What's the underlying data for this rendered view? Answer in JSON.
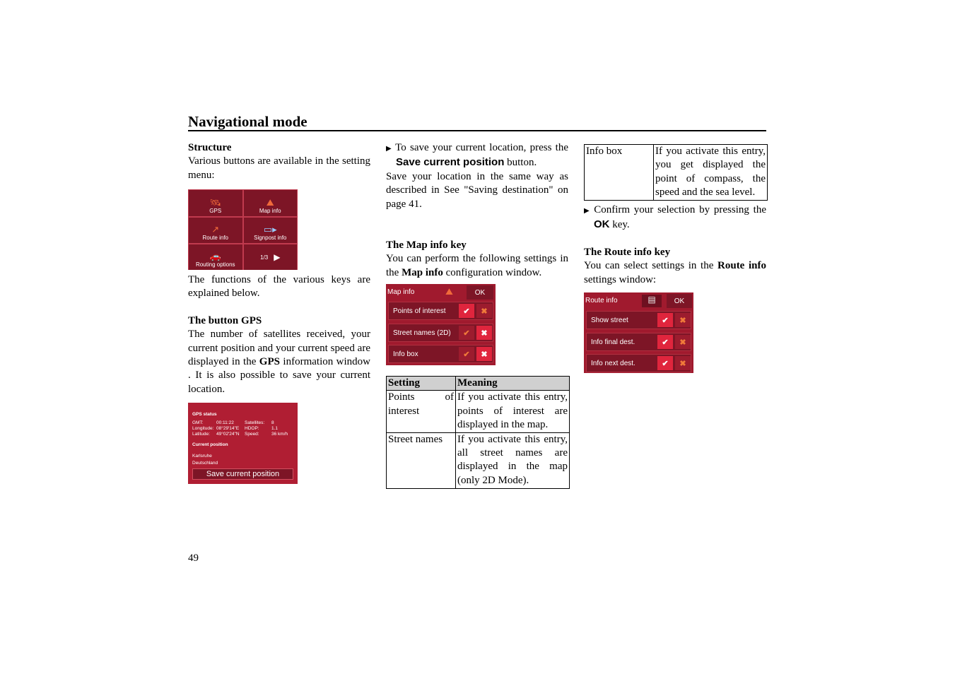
{
  "header": {
    "title": "Navigational mode"
  },
  "page_number": "49",
  "col1": {
    "structure_heading": "Structure",
    "structure_text": "Various buttons are available in the setting menu:",
    "menu": {
      "items": [
        "GPS",
        "Map info",
        "Route info",
        "Signpost info",
        "Routing options"
      ],
      "page": "1/3",
      "icons": [
        "satellite-icon",
        "map-icon",
        "route-icon",
        "signpost-icon",
        "routing-options-icon",
        "next-arrow-icon"
      ]
    },
    "functions_text": "The functions of the various keys are explained below.",
    "gps_heading": "The button GPS",
    "gps_text_1": "The number of satellites received, your current position and your current speed are displayed in the ",
    "gps_bold": "GPS",
    "gps_text_2": " information window . It is also possible to save your current location.",
    "gps_status": {
      "title": "GPS status",
      "gmt_label": "GMT:",
      "gmt": "00:11:22",
      "lon_label": "Longitude:",
      "lon": "08°29'14\"E",
      "lat_label": "Latitude:",
      "lat": "49°02'24\"N",
      "sat_label": "Satellites:",
      "sat": "8",
      "hdop_label": "HDOP:",
      "hdop": "1.1",
      "speed_label": "Speed:",
      "speed": "36 km/h",
      "position_title": "Current position",
      "city": "Karlsruhe",
      "country": "Deutschland",
      "save_button": "Save current position"
    }
  },
  "col2": {
    "bullet_1a": "To save your current location, press the ",
    "bullet_1_bold": "Save current position",
    "bullet_1b": " button.",
    "save_text": "Save your location in the same way as described in See \"Saving destination\" on page 41.",
    "mapinfo_heading": "The Map info key",
    "mapinfo_text_1": "You can perform the following settings in the ",
    "mapinfo_bold": "Map info",
    "mapinfo_text_2": " configuration window.",
    "mapinfo_window": {
      "title": "Map info",
      "ok": "OK",
      "rows": [
        {
          "label": "Points of interest",
          "checked": true
        },
        {
          "label": "Street names (2D)",
          "checked": false
        },
        {
          "label": "Info box",
          "checked": false
        }
      ]
    },
    "table": {
      "headers": [
        "Setting",
        "Meaning"
      ],
      "rows": [
        [
          "Points of interest",
          "If you activate this entry, points of interest are displayed in the map."
        ],
        [
          "Street names",
          "If you activate this entry, all street names are displayed in the map (only 2D Mode)."
        ]
      ]
    }
  },
  "col3": {
    "table": {
      "rows": [
        [
          "Info box",
          "If you activate this entry, you get displayed the point of compass, the speed and the sea level."
        ]
      ]
    },
    "bullet_1a": "Confirm your selection by pressing the ",
    "bullet_1_bold": "OK",
    "bullet_1b": " key.",
    "routeinfo_heading": "The Route info key",
    "routeinfo_text_1": "You can select settings in the ",
    "routeinfo_bold": "Route info",
    "routeinfo_text_2": " settings window:",
    "routeinfo_window": {
      "title": "Route info",
      "ok": "OK",
      "rows": [
        {
          "label": "Show street",
          "checked": true
        },
        {
          "label": "Info final dest.",
          "checked": true
        },
        {
          "label": "Info next dest.",
          "checked": true
        }
      ]
    }
  }
}
